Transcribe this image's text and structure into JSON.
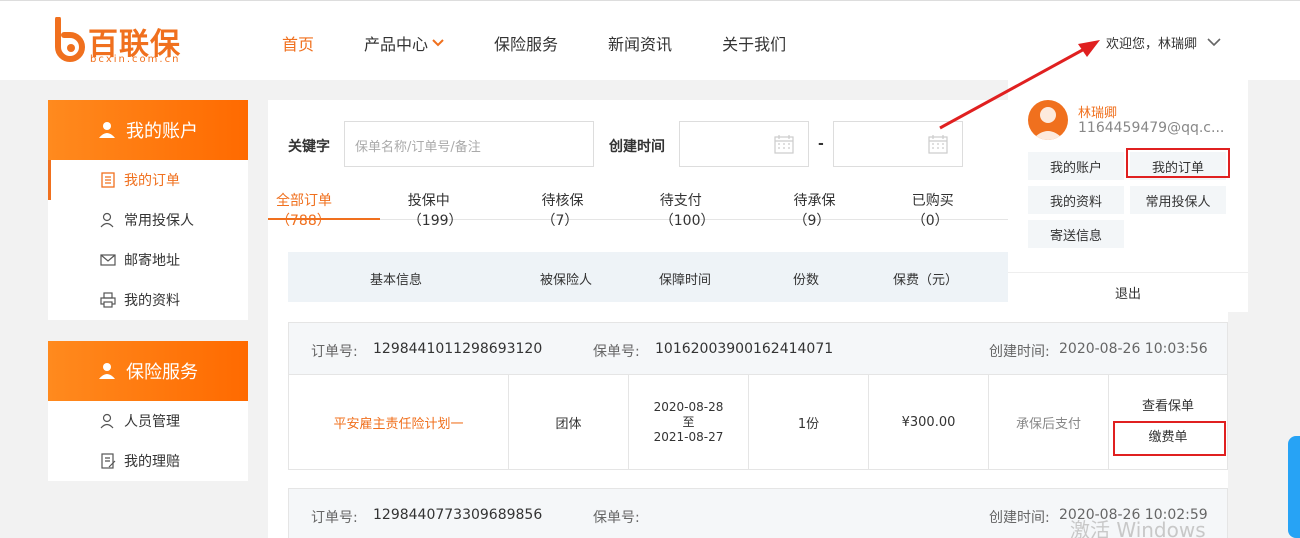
{
  "header": {
    "logo_text": "百联保",
    "logo_sub": "bcxin.com.cn",
    "nav": [
      {
        "label": "首页",
        "active": true
      },
      {
        "label": "产品中心",
        "has_dropdown": true
      },
      {
        "label": "保险服务"
      },
      {
        "label": "新闻资讯"
      },
      {
        "label": "关于我们"
      }
    ],
    "welcome": "欢迎您，林瑞卿"
  },
  "sidebar": {
    "account": {
      "title": "我的账户",
      "items": [
        {
          "label": "我的订单",
          "icon": "order-icon",
          "active": true
        },
        {
          "label": "常用投保人",
          "icon": "user-icon"
        },
        {
          "label": "邮寄地址",
          "icon": "mail-icon"
        },
        {
          "label": "我的资料",
          "icon": "printer-icon"
        }
      ]
    },
    "service": {
      "title": "保险服务",
      "items": [
        {
          "label": "人员管理",
          "icon": "user-icon"
        },
        {
          "label": "我的理赔",
          "icon": "claim-icon"
        }
      ]
    }
  },
  "filters": {
    "keyword_label": "关键字",
    "keyword_placeholder": "保单名称/订单号/备注",
    "created_label": "创建时间",
    "range_sep": "-"
  },
  "tabs": [
    {
      "label": "全部订单（788）",
      "active": true
    },
    {
      "label": "投保中（199）"
    },
    {
      "label": "待核保（7）"
    },
    {
      "label": "待支付（100）"
    },
    {
      "label": "待承保（9）"
    },
    {
      "label": "已购买（0）"
    }
  ],
  "table": {
    "headers": [
      "基本信息",
      "被保险人",
      "保障时间",
      "份数",
      "保费（元）"
    ]
  },
  "orders": [
    {
      "order_no_label": "订单号:",
      "order_no": "1298441011298693120",
      "policy_no_label": "保单号:",
      "policy_no": "10162003900162414071",
      "created_label": "创建时间:",
      "created": "2020-08-26 10:03:56",
      "product": "平安雇主责任险计划一",
      "insured": "团体",
      "start": "2020-08-28",
      "to": "至",
      "end": "2021-08-27",
      "copies": "1份",
      "premium": "¥300.00",
      "status": "承保后支付",
      "action1": "查看保单",
      "action2": "缴费单"
    },
    {
      "order_no_label": "订单号:",
      "order_no": "1298440773309689856",
      "policy_no_label": "保单号:",
      "policy_no": "",
      "created_label": "创建时间:",
      "created": "2020-08-26 10:02:59"
    }
  ],
  "dropdown": {
    "name": "林瑞卿",
    "email": "1164459479@qq.c...",
    "buttons": [
      "我的账户",
      "我的订单",
      "我的资料",
      "常用投保人",
      "寄送信息"
    ],
    "logout": "退出"
  },
  "watermark": "激活 Windows",
  "colors": {
    "brand": "#f0701e",
    "highlight": "#e02020"
  }
}
